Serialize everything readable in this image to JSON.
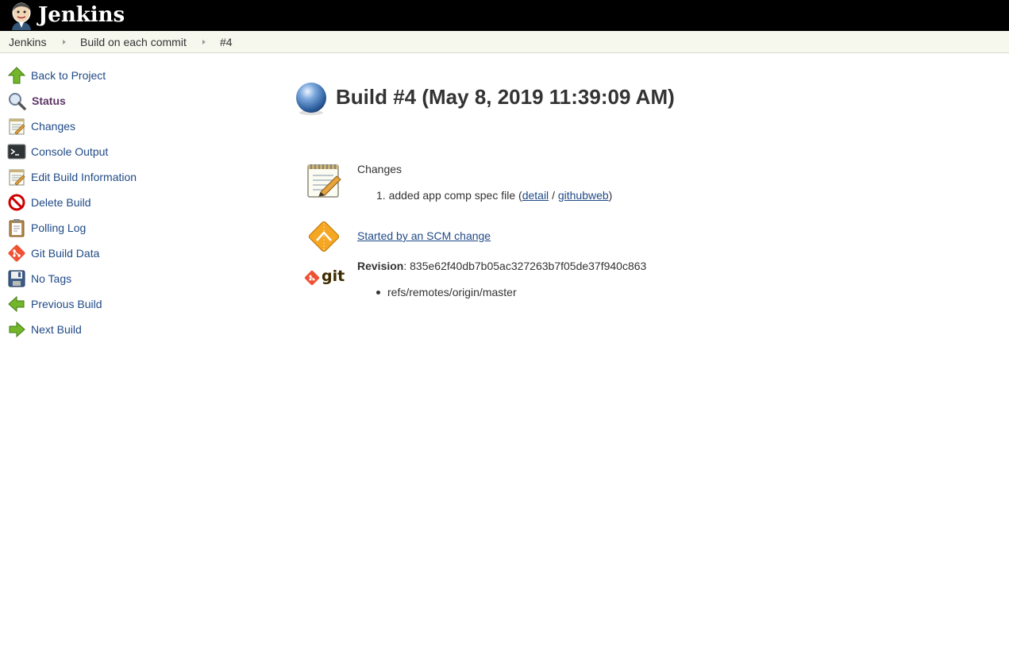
{
  "header": {
    "brand": "Jenkins"
  },
  "breadcrumb": [
    "Jenkins",
    "Build on each commit",
    "#4"
  ],
  "sidebar": {
    "items": [
      {
        "label": "Back to Project",
        "icon": "up-arrow-icon"
      },
      {
        "label": "Status",
        "icon": "magnifier-icon",
        "active": true
      },
      {
        "label": "Changes",
        "icon": "notepad-icon"
      },
      {
        "label": "Console Output",
        "icon": "terminal-icon"
      },
      {
        "label": "Edit Build Information",
        "icon": "notepad-pencil-icon"
      },
      {
        "label": "Delete Build",
        "icon": "no-entry-icon"
      },
      {
        "label": "Polling Log",
        "icon": "clipboard-icon"
      },
      {
        "label": "Git Build Data",
        "icon": "git-icon"
      },
      {
        "label": "No Tags",
        "icon": "floppy-icon"
      },
      {
        "label": "Previous Build",
        "icon": "left-arrow-icon"
      },
      {
        "label": "Next Build",
        "icon": "right-arrow-icon"
      }
    ]
  },
  "main": {
    "title": "Build #4 (May 8, 2019 11:39:09 AM)",
    "changes": {
      "heading": "Changes",
      "items": [
        {
          "number": "1.",
          "text": "added app comp spec file",
          "open": "(",
          "detail": "detail",
          "sep": "/",
          "githubweb": "githubweb",
          "close": ")"
        }
      ]
    },
    "cause": "Started by an SCM change",
    "git": {
      "logo_text": "git",
      "revision_label": "Revision",
      "revision_colon": ":",
      "revision": "835e62f40db7b05ac327263b7f05de37f940c863",
      "branches": [
        "refs/remotes/origin/master"
      ]
    }
  },
  "colors": {
    "header_bg": "#000000",
    "breadcrumb_bg": "#f6f8ee",
    "link": "#204a87",
    "active_link": "#5c3566",
    "build_status_blue": "#3465a4"
  }
}
